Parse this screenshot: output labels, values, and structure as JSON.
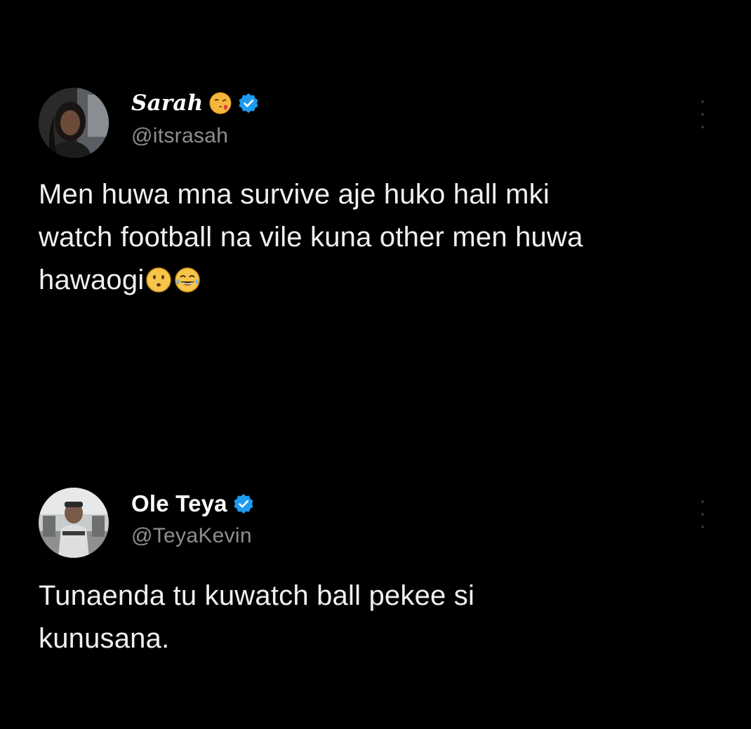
{
  "tweets": [
    {
      "author": {
        "display_name": "Sarah",
        "handle": "@itsrasah",
        "name_emoji": "face-blowing-kiss",
        "verified": true,
        "avatar": "avatar-photo-woman"
      },
      "text_lines": [
        "Men huwa mna survive aje huko hall mki",
        "watch football na vile kuna other men huwa",
        "hawaogi"
      ],
      "trailing_emojis": [
        "hushed-face-emoji",
        "face-with-tears-of-joy-emoji"
      ],
      "more_icon": "more-vertical-icon"
    },
    {
      "author": {
        "display_name": "Ole Teya",
        "handle": "@TeyaKevin",
        "verified": true,
        "avatar": "avatar-photo-man"
      },
      "text_lines": [
        "Tunaenda tu kuwatch ball pekee si",
        "kunusana."
      ],
      "more_icon": "more-vertical-icon"
    }
  ],
  "colors": {
    "background": "#000000",
    "text": "#e7e9ea",
    "secondary_text": "#8b8f93",
    "verified_badge": "#1d9bf0"
  }
}
